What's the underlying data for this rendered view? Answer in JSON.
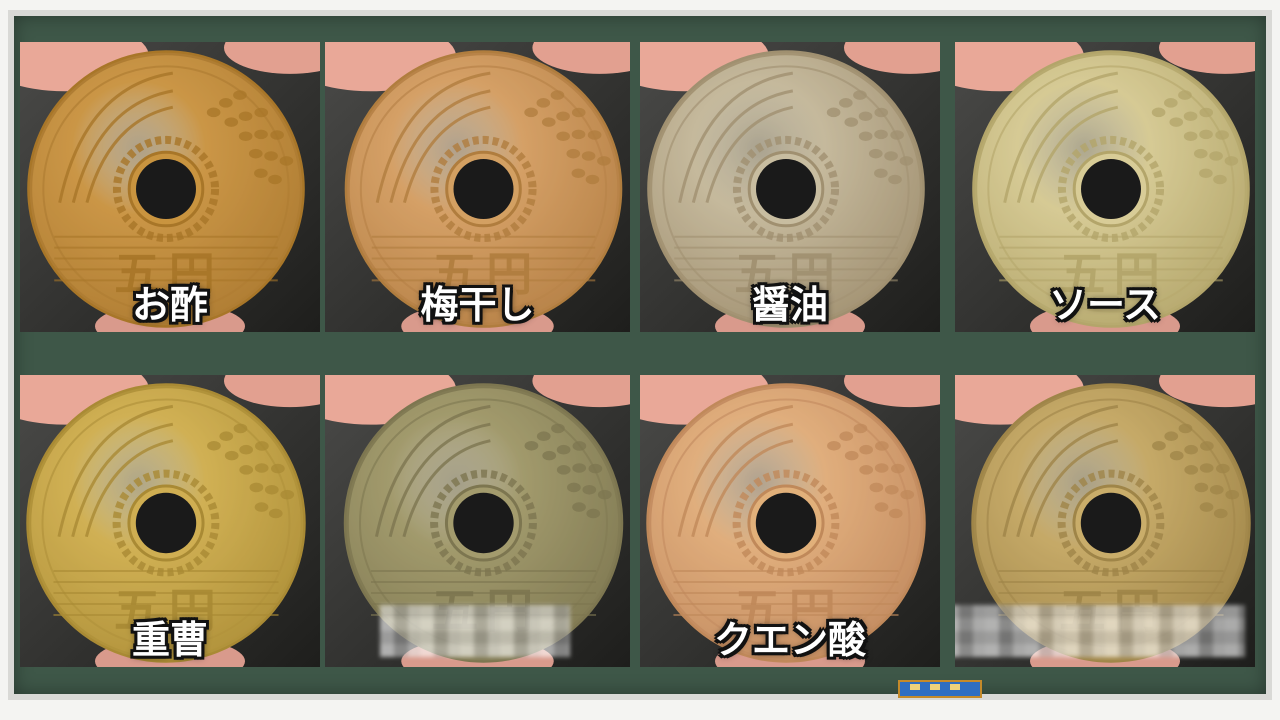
{
  "tiles": [
    {
      "label": "お酢",
      "tone": "#c9943f",
      "rim": "#a87628",
      "tint": "#d4a26a"
    },
    {
      "label": "梅干し",
      "tone": "#d3a062",
      "rim": "#b07d3e",
      "tint": "#dba07a"
    },
    {
      "label": "醤油",
      "tone": "#c8bda0",
      "rim": "#a09070",
      "tint": "#b8a48a"
    },
    {
      "label": "ソース",
      "tone": "#d8cc97",
      "rim": "#b3a56a",
      "tint": "#cfc08a"
    },
    {
      "label": "重曹",
      "tone": "#cfae52",
      "rim": "#a98a34",
      "tint": "#d9bb5c"
    },
    {
      "label": "",
      "tone": "#a39b6d",
      "rim": "#7d7650",
      "tint": "#9c9468"
    },
    {
      "label": "クエン酸",
      "tone": "#e1b07a",
      "rim": "#c0895a",
      "tint": "#e0a88a"
    },
    {
      "label": "",
      "tone": "#c9ad6a",
      "rim": "#9f8548",
      "tint": "#b89a60"
    }
  ],
  "coin": {
    "kanji_five": "五",
    "kanji_yen": "円"
  },
  "colors": {
    "board": "#3e5748",
    "caption_text": "#ffffff",
    "caption_outline": "#111111"
  },
  "icons": {
    "coin": "five-yen-coin-icon",
    "finger": "finger-icon"
  }
}
